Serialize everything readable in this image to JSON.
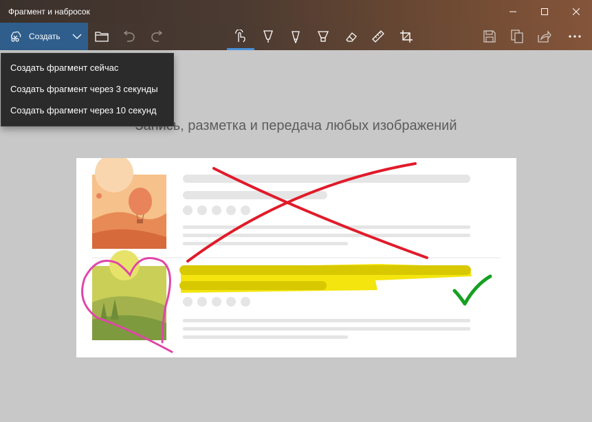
{
  "window": {
    "title": "Фрагмент и набросок"
  },
  "toolbar": {
    "create_label": "Создать",
    "active_tool": "touch-writing",
    "icons": [
      "open-folder-icon",
      "undo-icon",
      "redo-icon",
      "touch-writing-icon",
      "ballpoint-pen-icon",
      "pencil-icon",
      "highlighter-icon",
      "eraser-icon",
      "ruler-icon",
      "crop-icon",
      "save-icon",
      "copy-icon",
      "share-icon",
      "more-icon"
    ]
  },
  "create_menu": {
    "items": [
      {
        "label": "Создать фрагмент сейчас"
      },
      {
        "label": "Создать фрагмент через 3 секунды"
      },
      {
        "label": "Создать фрагмент через 10 секунд"
      }
    ]
  },
  "main": {
    "headline": "Запись, разметка и передача любых изображений"
  },
  "colors": {
    "create_button": "#2f5e8c",
    "active_underline": "#4a90d9",
    "canvas_background": "#c8c8c8",
    "ink_red": "#e01b2a",
    "ink_yellow": "#f2e400",
    "ink_green": "#15a021",
    "ink_pink": "#e046a8"
  }
}
